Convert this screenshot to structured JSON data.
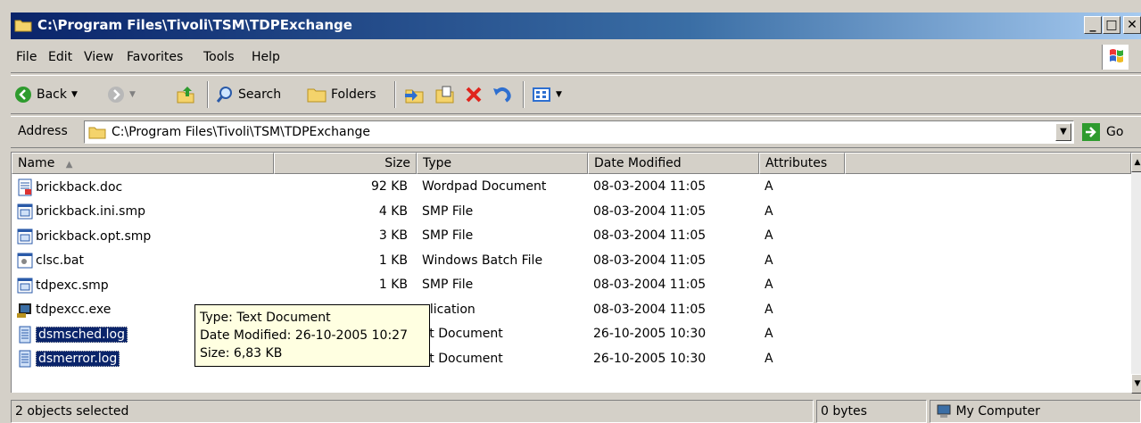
{
  "window": {
    "title": "C:\\Program Files\\Tivoli\\TSM\\TDPExchange",
    "caption_buttons": [
      "minimize",
      "maximize",
      "close"
    ]
  },
  "menubar": {
    "items": [
      {
        "label": "File"
      },
      {
        "label": "Edit"
      },
      {
        "label": "View"
      },
      {
        "label": "Favorites"
      },
      {
        "label": "Tools"
      },
      {
        "label": "Help"
      }
    ]
  },
  "toolbar": {
    "back_label": "Back",
    "search_label": "Search",
    "folders_label": "Folders",
    "icons": [
      "back-icon",
      "forward-icon",
      "up-folder-icon",
      "search-icon",
      "folders-icon",
      "move-to-icon",
      "copy-to-icon",
      "delete-icon",
      "undo-icon",
      "views-icon"
    ]
  },
  "address": {
    "label": "Address",
    "value": "C:\\Program Files\\Tivoli\\TSM\\TDPExchange",
    "go_label": "Go"
  },
  "columns": {
    "name": "Name",
    "size": "Size",
    "type": "Type",
    "date": "Date Modified",
    "attributes": "Attributes"
  },
  "files": [
    {
      "name": "brickback.doc",
      "size": "92 KB",
      "type": "Wordpad Document",
      "date": "08-03-2004 11:05",
      "attr": "A",
      "icon": "doc-icon",
      "selected": false
    },
    {
      "name": "brickback.ini.smp",
      "size": "4 KB",
      "type": "SMP File",
      "date": "08-03-2004 11:05",
      "attr": "A",
      "icon": "smp-file-icon",
      "selected": false
    },
    {
      "name": "brickback.opt.smp",
      "size": "3 KB",
      "type": "SMP File",
      "date": "08-03-2004 11:05",
      "attr": "A",
      "icon": "smp-file-icon",
      "selected": false
    },
    {
      "name": "clsc.bat",
      "size": "1 KB",
      "type": "Windows Batch File",
      "date": "08-03-2004 11:05",
      "attr": "A",
      "icon": "batch-file-icon",
      "selected": false
    },
    {
      "name": "tdpexc.smp",
      "size": "1 KB",
      "type": "SMP File",
      "date": "08-03-2004 11:05",
      "attr": "A",
      "icon": "smp-file-icon",
      "selected": false
    },
    {
      "name": "tdpexcc.exe",
      "size": "",
      "type": "plication",
      "date": "08-03-2004 11:05",
      "attr": "A",
      "icon": "exe-icon",
      "selected": false
    },
    {
      "name": "dsmsched.log",
      "size": "",
      "type": "xt Document",
      "date": "26-10-2005 10:30",
      "attr": "A",
      "icon": "log-file-icon",
      "selected": true
    },
    {
      "name": "dsmerror.log",
      "size": "",
      "type": "xt Document",
      "date": "26-10-2005 10:30",
      "attr": "A",
      "icon": "log-file-icon",
      "selected": true
    }
  ],
  "tooltip": {
    "line1": "Type: Text Document",
    "line2": "Date Modified: 26-10-2005 10:27",
    "line3": "Size: 6,83 KB"
  },
  "statusbar": {
    "selection": "2 objects selected",
    "size": "0 bytes",
    "zone": "My Computer"
  },
  "colors": {
    "titlebar_start": "#0a246a",
    "selection": "#0a246a",
    "tooltip_bg": "#ffffe1",
    "chrome": "#d4d0c8"
  }
}
